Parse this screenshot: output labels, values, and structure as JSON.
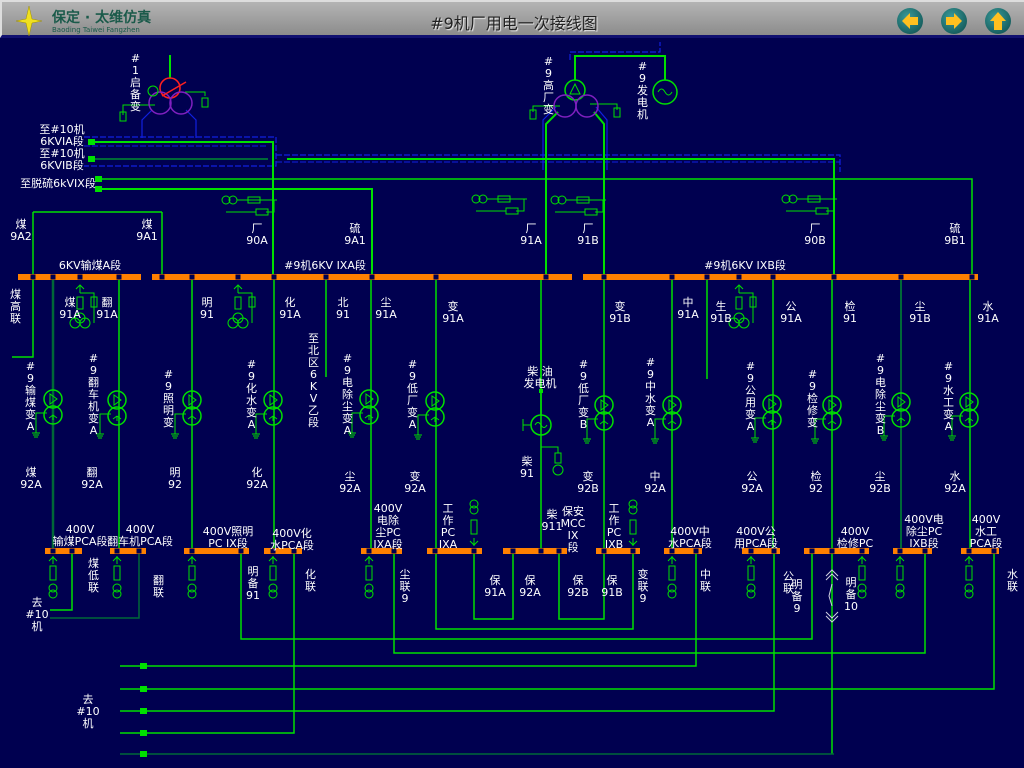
{
  "header": {
    "brand": "保定 · 太维仿真",
    "brand_sub": "Baoding Taiwei Fangzhen",
    "title": "#9机厂用电一次接线图",
    "nav": [
      {
        "name": "back",
        "icon": "arrow-left-icon"
      },
      {
        "name": "forward",
        "icon": "arrow-right-icon"
      },
      {
        "name": "up",
        "icon": "arrow-up-icon"
      }
    ]
  },
  "colors": {
    "background": "#000050",
    "wire": "#00e000",
    "wire_dark": "#006838",
    "bus": "#ff8000",
    "boundary": "#1020e0",
    "winding": "#8020c0",
    "energized": "#ff2020",
    "text": "#e8e8ff"
  },
  "labels": [
    [
      "#1启备变"
    ],
    [
      "至#10机",
      "6KVIA段"
    ],
    [
      "至#10机",
      "6KVIB段"
    ],
    [
      "至脱硫6kVIX段"
    ],
    [
      "煤",
      "9A2"
    ],
    [
      "煤",
      "9A1"
    ],
    [
      "厂",
      "90A"
    ],
    [
      "硫",
      "9A1"
    ],
    [
      "#9高厂变"
    ],
    [
      "#9发电机"
    ],
    [
      "厂",
      "91A"
    ],
    [
      "厂",
      "91B"
    ],
    [
      "厂",
      "90B"
    ],
    [
      "硫",
      "9B1"
    ],
    [
      "6KV输煤A段"
    ],
    [
      "#9机6KV IXA段"
    ],
    [
      "#9机6KV IXB段"
    ],
    [
      "煤高联"
    ],
    [
      "煤",
      "91A"
    ],
    [
      "翻",
      "91A"
    ],
    [
      "明",
      "91"
    ],
    [
      "化",
      "91A"
    ],
    [
      "北",
      "91"
    ],
    [
      "尘",
      "91A"
    ],
    [
      "变",
      "91A"
    ],
    [
      "变",
      "91B"
    ],
    [
      "中",
      "91A"
    ],
    [
      "生",
      "91B"
    ],
    [
      "公",
      "91A"
    ],
    [
      "检",
      "91"
    ],
    [
      "尘",
      "91B"
    ],
    [
      "水",
      "91A"
    ],
    [
      "至北区6KV乙段"
    ],
    [
      "#9输煤变A"
    ],
    [
      "#9翻车机变A"
    ],
    [
      "#9照明变"
    ],
    [
      "#9化水变A"
    ],
    [
      "#9电除尘变A"
    ],
    [
      "#9低厂变A"
    ],
    [
      "柴 油",
      "发电机"
    ],
    [
      "#9低厂变B"
    ],
    [
      "#9中水变A"
    ],
    [
      "#9公用变A"
    ],
    [
      "#9检修变"
    ],
    [
      "#9电除尘变B"
    ],
    [
      "#9水工变A"
    ],
    [
      "煤",
      "92A"
    ],
    [
      "翻",
      "92A"
    ],
    [
      "明",
      "92"
    ],
    [
      "化",
      "92A"
    ],
    [
      "尘",
      "92A"
    ],
    [
      "变",
      "92A"
    ],
    [
      "柴",
      "91"
    ],
    [
      "变",
      "92B"
    ],
    [
      "中",
      "92A"
    ],
    [
      "公",
      "92A"
    ],
    [
      "检",
      "92"
    ],
    [
      "尘",
      "92B"
    ],
    [
      "水",
      "92A"
    ],
    [
      "400V",
      "输煤PCA段"
    ],
    [
      "400V",
      "翻车机PCA段"
    ],
    [
      "400V照明",
      "PC IX段"
    ],
    [
      "400V化",
      "水PCA段"
    ],
    [
      "400V",
      "电除",
      "尘PC",
      "IXA段"
    ],
    [
      "工",
      "作",
      "PC",
      "IXA"
    ],
    [
      "柴",
      "911"
    ],
    [
      "保安",
      "MCC",
      "IX",
      "段"
    ],
    [
      "工",
      "作",
      "PC",
      "IXB"
    ],
    [
      "400V中",
      "水PCA段"
    ],
    [
      "400V公",
      "用PCA段"
    ],
    [
      "400V",
      "检修PC"
    ],
    [
      "400V电",
      "除尘PC",
      "IXB段"
    ],
    [
      "400V",
      "水工",
      "PCA段"
    ],
    [
      "煤低联"
    ],
    [
      "翻联"
    ],
    [
      "明",
      "备",
      "91"
    ],
    [
      "化联"
    ],
    [
      "尘",
      "联",
      "9"
    ],
    [
      "保",
      "91A"
    ],
    [
      "保",
      "92A"
    ],
    [
      "保",
      "92B"
    ],
    [
      "保",
      "91B"
    ],
    [
      "变",
      "联",
      "9"
    ],
    [
      "中联"
    ],
    [
      "公联"
    ],
    [
      "明",
      "备",
      "9"
    ],
    [
      "明",
      "备",
      "10"
    ],
    [
      "水联"
    ],
    [
      "去",
      "#10",
      "机"
    ],
    [
      "去",
      "#10",
      "机"
    ]
  ]
}
